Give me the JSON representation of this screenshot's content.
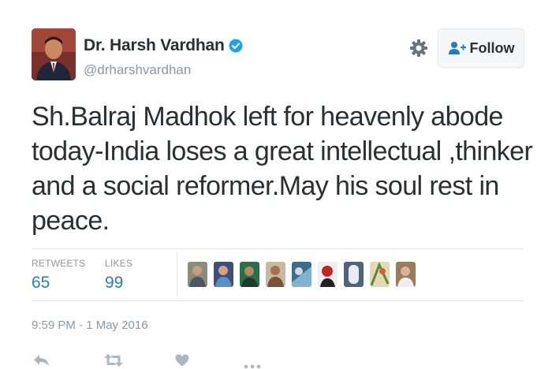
{
  "user": {
    "full_name": "Dr. Harsh Vardhan",
    "handle": "@drharshvardhan",
    "verified": true
  },
  "header": {
    "settings_icon": "gear-icon",
    "follow_label": "Follow",
    "follow_icon": "add-user-icon"
  },
  "tweet": {
    "lines": [
      "Sh.Balraj Madhok left for heavenly abode",
      "today-India loses a great intellectual ,thinker",
      "and a social reformer.May his soul rest in",
      "peace."
    ]
  },
  "stats": {
    "retweets_label": "RETWEETS",
    "retweets_value": "65",
    "likes_label": "LIKES",
    "likes_value": "99",
    "liker_avatar_count": 9
  },
  "timestamp": "9:59 PM - 1 May 2016",
  "actions": [
    "reply-icon",
    "retweet-icon",
    "like-icon",
    "more-icon"
  ],
  "colors": {
    "text": "#292f33",
    "secondary": "#8899a6",
    "accent": "#2b7bb9",
    "verified": "#1da1f2",
    "border": "#e1e8ed",
    "action_icon": "#aab8c2"
  }
}
